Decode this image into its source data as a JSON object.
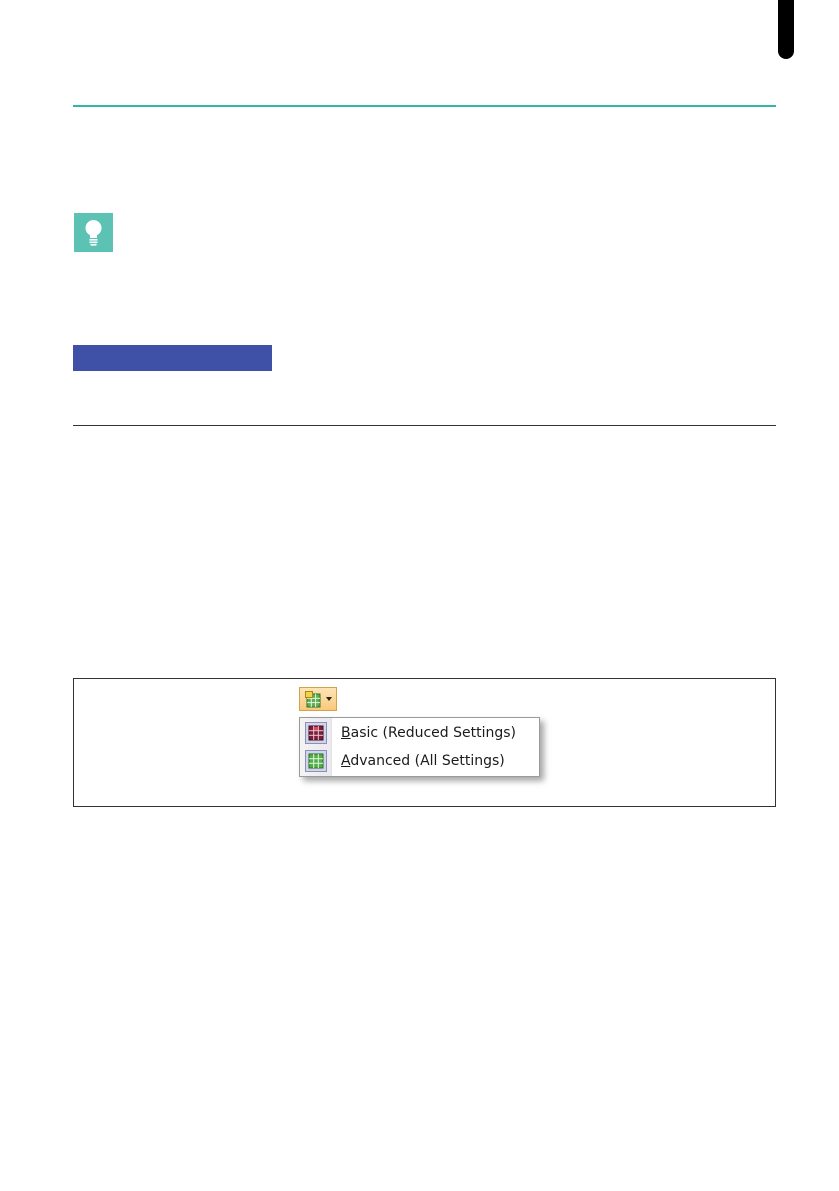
{
  "colors": {
    "accent_teal": "#33b5a3",
    "tip_icon_background": "#5bc2b4",
    "section_bar_blue": "#3f51a7",
    "menu_button_highlight": "#f9c97a"
  },
  "icons": {
    "tip": "lightbulb-icon",
    "dropdown_button": "grid-settings-icon",
    "dropdown_arrow": "chevron-down-icon",
    "basic_item": "basic-grid-icon",
    "advanced_item": "advanced-grid-icon"
  },
  "menu": {
    "items": [
      {
        "access_key": "B",
        "rest": "asic (Reduced Settings)"
      },
      {
        "access_key": "A",
        "rest": "dvanced (All Settings)"
      }
    ]
  }
}
